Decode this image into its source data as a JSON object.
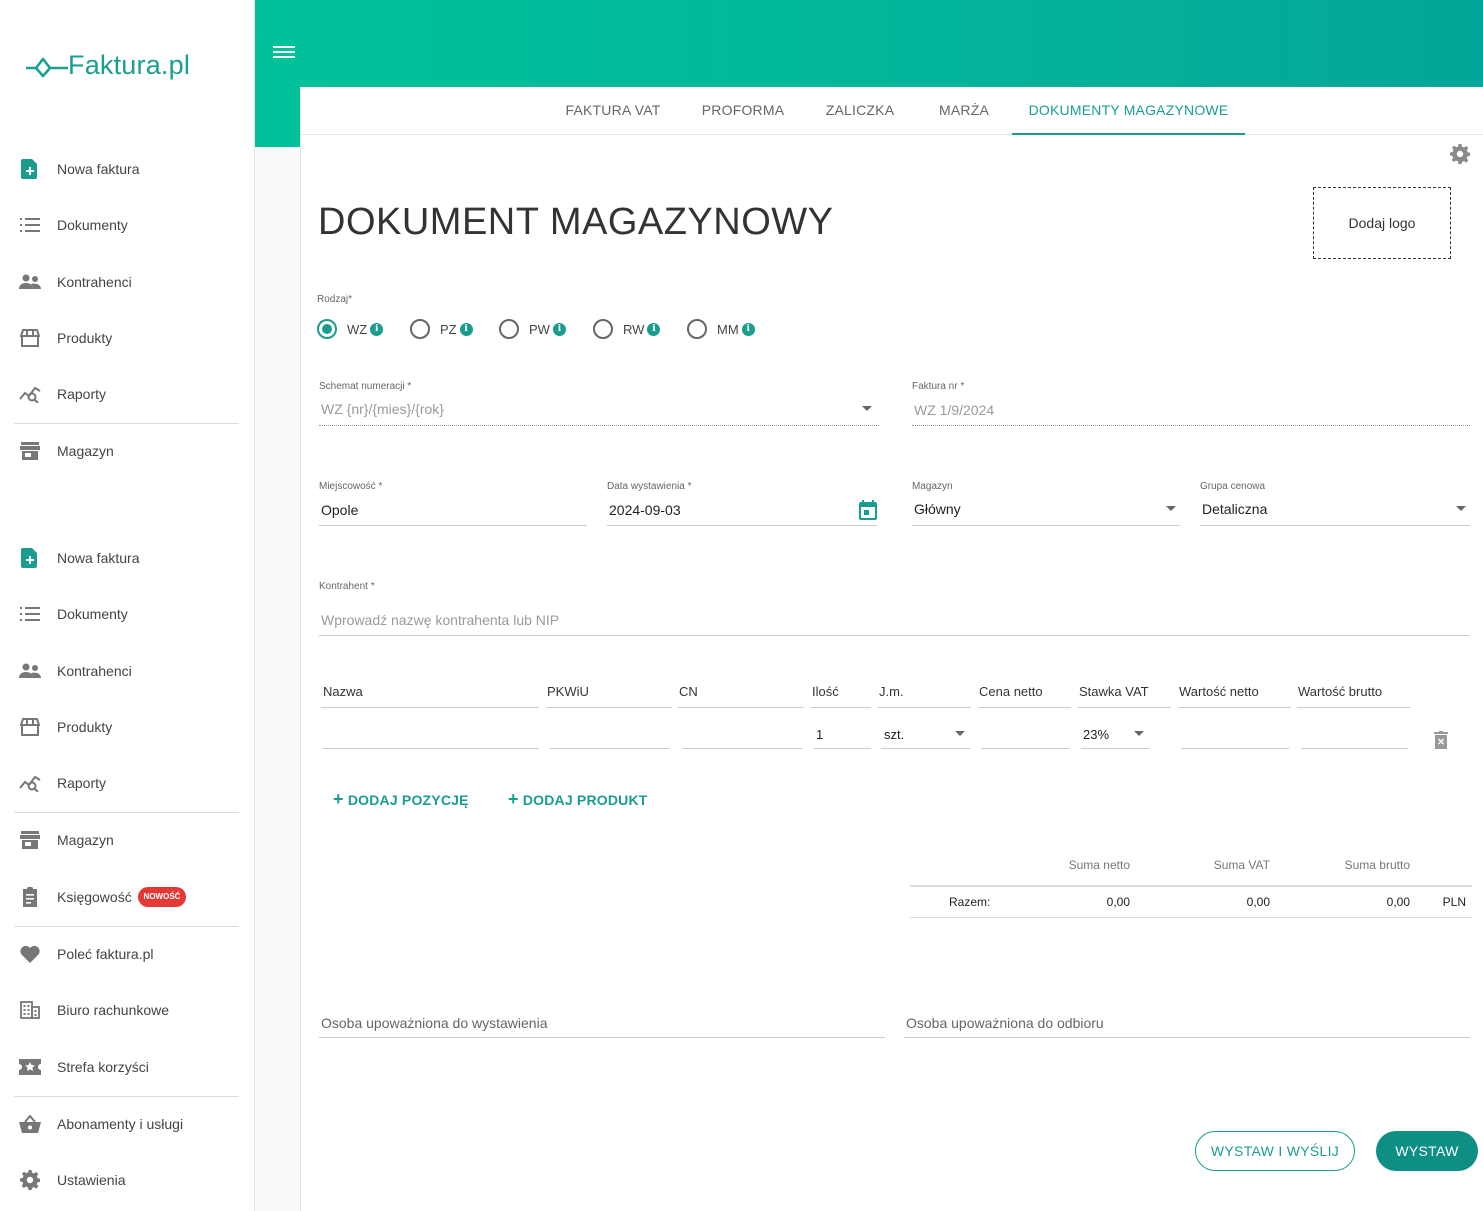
{
  "brand": {
    "logo_text": "Faktura.pl"
  },
  "sidebar": {
    "items": [
      {
        "label": "Nowa faktura",
        "icon": "new-document-icon"
      },
      {
        "label": "Dokumenty",
        "icon": "list-icon"
      },
      {
        "label": "Kontrahenci",
        "icon": "people-icon"
      },
      {
        "label": "Produkty",
        "icon": "store-icon"
      },
      {
        "label": "Raporty",
        "icon": "report-icon"
      },
      {
        "label": "Magazyn",
        "icon": "warehouse-icon"
      },
      {
        "label": "Nowa faktura",
        "icon": "new-document-icon"
      },
      {
        "label": "Dokumenty",
        "icon": "list-icon"
      },
      {
        "label": "Kontrahenci",
        "icon": "people-icon"
      },
      {
        "label": "Produkty",
        "icon": "store-icon"
      },
      {
        "label": "Raporty",
        "icon": "report-icon"
      },
      {
        "label": "Magazyn",
        "icon": "warehouse-icon"
      },
      {
        "label": "Księgowość",
        "icon": "clipboard-icon",
        "badge": "NOWOŚĆ"
      },
      {
        "label": "Poleć faktura.pl",
        "icon": "heart-icon"
      },
      {
        "label": "Biuro rachunkowe",
        "icon": "building-icon"
      },
      {
        "label": "Strefa korzyści",
        "icon": "ticket-icon"
      },
      {
        "label": "Abonamenty i usługi",
        "icon": "basket-icon"
      },
      {
        "label": "Ustawienia",
        "icon": "gear-icon"
      }
    ]
  },
  "tabs": [
    {
      "label": "FAKTURA VAT",
      "active": false
    },
    {
      "label": "PROFORMA",
      "active": false
    },
    {
      "label": "ZALICZKA",
      "active": false
    },
    {
      "label": "MARŻA",
      "active": false
    },
    {
      "label": "DOKUMENTY MAGAZYNOWE",
      "active": true
    }
  ],
  "form": {
    "title": "DOKUMENT MAGAZYNOWY",
    "add_logo": "Dodaj logo",
    "type_label": "Rodzaj*",
    "types": [
      {
        "label": "WZ",
        "checked": true
      },
      {
        "label": "PZ",
        "checked": false
      },
      {
        "label": "PW",
        "checked": false
      },
      {
        "label": "RW",
        "checked": false
      },
      {
        "label": "MM",
        "checked": false
      }
    ],
    "numbering_label": "Schemat numeracji *",
    "numbering_value": "WZ {nr}/{mies}/{rok}",
    "invoice_no_label": "Faktura nr *",
    "invoice_no_value": "WZ 1/9/2024",
    "city_label": "Miejscowość *",
    "city_value": "Opole",
    "date_label": "Data wystawienia *",
    "date_value": "2024-09-03",
    "warehouse_label": "Magazyn",
    "warehouse_value": "Główny",
    "price_group_label": "Grupa cenowa",
    "price_group_value": "Detaliczna",
    "contractor_label": "Kontrahent *",
    "contractor_placeholder": "Wprowadź nazwę kontrahenta lub NIP"
  },
  "items_table": {
    "headers": [
      "Nazwa",
      "PKWiU",
      "CN",
      "Ilość",
      "J.m.",
      "Cena netto",
      "Stawka VAT",
      "Wartość netto",
      "Wartość brutto"
    ],
    "row": {
      "nazwa": "",
      "pkwiu": "",
      "cn": "",
      "ilosc": "1",
      "jm": "szt.",
      "cena_netto": "",
      "stawka_vat": "23%",
      "wartosc_netto": "",
      "wartosc_brutto": ""
    },
    "add_position": "DODAJ POZYCJĘ",
    "add_product": "DODAJ PRODUKT"
  },
  "summary": {
    "headers": [
      "Suma netto",
      "Suma VAT",
      "Suma brutto"
    ],
    "row_label": "Razem:",
    "values": [
      "0,00",
      "0,00",
      "0,00"
    ],
    "currency": "PLN"
  },
  "signatures": {
    "issuer": "Osoba upoważniona do wystawienia",
    "receiver": "Osoba upoważniona do odbioru"
  },
  "actions": {
    "issue_send": "WYSTAW I WYŚLIJ",
    "issue": "WYSTAW"
  },
  "colors": {
    "accent": "#1a9d8f",
    "header_gradient_start": "#00c29a",
    "header_gradient_end": "#04a59a",
    "badge": "#e53935"
  }
}
